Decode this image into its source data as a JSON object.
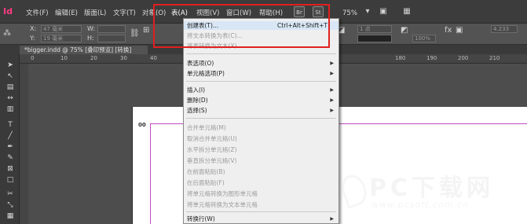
{
  "app": {
    "logo": "Id"
  },
  "menubar": {
    "items": [
      "文件(F)",
      "编辑(E)",
      "版面(L)",
      "文字(T)",
      "对象(O)",
      "表(A)",
      "视图(V)",
      "窗口(W)",
      "帮助(H)"
    ],
    "br_label": "Br",
    "st_label": "St",
    "zoom": "75%"
  },
  "controlbar": {
    "x_label": "X:",
    "y_label": "Y:",
    "x_value": "47 毫米",
    "y_value": "19 毫米",
    "w_label": "W:",
    "h_label": "H:",
    "stroke_weight": "1 点",
    "scale": "100%",
    "size_value": "4.233"
  },
  "tab": {
    "label": "*bigger.indd @ 75% [叠印预览] [转换]"
  },
  "ruler": {
    "top_ticks": [
      "0",
      "10",
      "20",
      "30",
      "40",
      "50",
      "60"
    ],
    "right_ticks": [
      "180",
      "190",
      "200",
      "210"
    ],
    "left_ticks": [
      "00"
    ]
  },
  "page": {
    "label": "00"
  },
  "table_menu": {
    "items": [
      {
        "label": "创建表(T)...",
        "shortcut": "Ctrl+Alt+Shift+T",
        "enabled": true,
        "highlight": true
      },
      {
        "label": "将文本转换为表(C)...",
        "enabled": false
      },
      {
        "label": "将表转换为文本(X)...",
        "enabled": false
      },
      {
        "label": "表选项(O)",
        "enabled": true,
        "submenu": true
      },
      {
        "label": "单元格选项(P)",
        "enabled": true,
        "submenu": true
      },
      {
        "label": "插入(I)",
        "enabled": true,
        "submenu": true
      },
      {
        "label": "删除(D)",
        "enabled": true,
        "submenu": true
      },
      {
        "label": "选择(S)",
        "enabled": true,
        "submenu": true
      },
      {
        "label": "合并单元格(M)",
        "enabled": false
      },
      {
        "label": "取消合并单元格(U)",
        "enabled": false
      },
      {
        "label": "水平拆分单元格(Z)",
        "enabled": false
      },
      {
        "label": "垂直拆分单元格(V)",
        "enabled": false
      },
      {
        "label": "在前面粘贴(B)",
        "enabled": false
      },
      {
        "label": "在后面粘贴(F)",
        "enabled": false
      },
      {
        "label": "将单元格转换为图形单元格",
        "enabled": false
      },
      {
        "label": "将单元格转换为文本单元格",
        "enabled": false
      },
      {
        "label": "转换行(W)",
        "enabled": true,
        "submenu": true
      }
    ]
  },
  "watermark": {
    "title": "PC下载网",
    "url": "www.pcsoft.com.cn"
  },
  "colors": {
    "accent": "#ff3a85",
    "highlight_box": "#e02020",
    "menu_highlight": "#d8e6f5"
  }
}
